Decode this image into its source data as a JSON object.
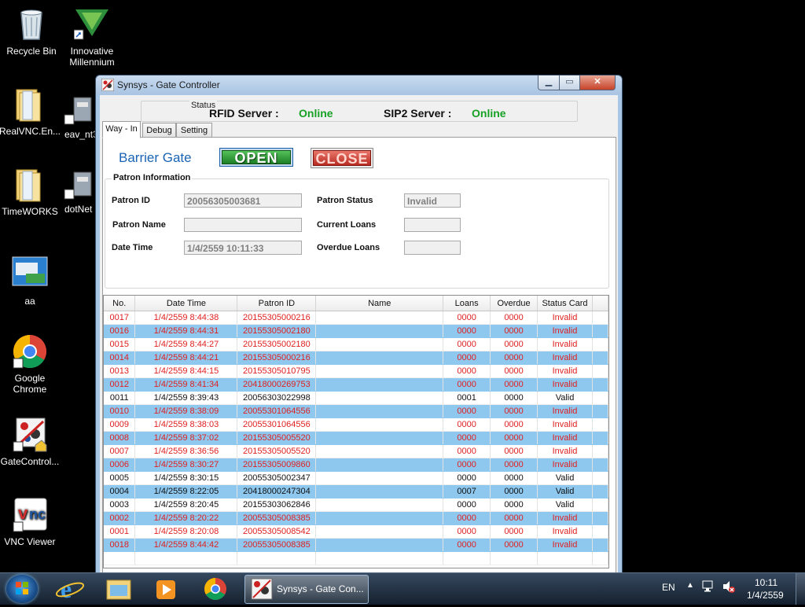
{
  "desktop": {
    "icons": [
      {
        "label": "Recycle Bin"
      },
      {
        "label": "Innovative Millennium"
      },
      {
        "label": "RealVNC.En..."
      },
      {
        "label": "eav_nt3"
      },
      {
        "label": "TimeWORKS"
      },
      {
        "label": "dotNet"
      },
      {
        "label": "aa"
      },
      {
        "label": "Google Chrome"
      },
      {
        "label": "GateControl..."
      },
      {
        "label": "VNC Viewer"
      }
    ]
  },
  "window": {
    "title": "Synsys - Gate Controller",
    "controls": {
      "minimize": "▁",
      "maximize": "▭",
      "close": "✕"
    }
  },
  "status": {
    "legend": "Status",
    "rfid_label": "RFID Server :",
    "rfid_value": "Online",
    "sip2_label": "SIP2 Server :",
    "sip2_value": "Online",
    "online_color": "#17a124"
  },
  "tabs": [
    {
      "label": "Way - In",
      "active": true
    },
    {
      "label": "Debug",
      "active": false
    },
    {
      "label": "Setting",
      "active": false
    }
  ],
  "gate": {
    "label": "Barrier Gate",
    "open_label": "OPEN",
    "close_label": "CLOSE"
  },
  "patron": {
    "legend": "Patron Information",
    "id_label": "Patron ID",
    "id_value": "20056305003681",
    "name_label": "Patron Name",
    "name_value": "",
    "datetime_label": "Date Time",
    "datetime_value": "1/4/2559 10:11:33",
    "status_label": "Patron Status",
    "status_value": "Invalid",
    "loans_label": "Current Loans",
    "loans_value": "",
    "overdue_label": "Overdue Loans",
    "overdue_value": ""
  },
  "log": {
    "columns": [
      "No.",
      "Date Time",
      "Patron ID",
      "Name",
      "Loans",
      "Overdue",
      "Status Card"
    ],
    "rows": [
      {
        "no": "0017",
        "datetime": "1/4/2559 8:44:38",
        "patron_id": "20155305000216",
        "name": "",
        "loans": "0000",
        "overdue": "0000",
        "status": "Invalid"
      },
      {
        "no": "0016",
        "datetime": "1/4/2559 8:44:31",
        "patron_id": "20155305002180",
        "name": "",
        "loans": "0000",
        "overdue": "0000",
        "status": "Invalid"
      },
      {
        "no": "0015",
        "datetime": "1/4/2559 8:44:27",
        "patron_id": "20155305002180",
        "name": "",
        "loans": "0000",
        "overdue": "0000",
        "status": "Invalid"
      },
      {
        "no": "0014",
        "datetime": "1/4/2559 8:44:21",
        "patron_id": "20155305000216",
        "name": "",
        "loans": "0000",
        "overdue": "0000",
        "status": "Invalid"
      },
      {
        "no": "0013",
        "datetime": "1/4/2559 8:44:15",
        "patron_id": "20155305010795",
        "name": "",
        "loans": "0000",
        "overdue": "0000",
        "status": "Invalid"
      },
      {
        "no": "0012",
        "datetime": "1/4/2559 8:41:34",
        "patron_id": "20418000269753",
        "name": "",
        "loans": "0000",
        "overdue": "0000",
        "status": "Invalid"
      },
      {
        "no": "0011",
        "datetime": "1/4/2559 8:39:43",
        "patron_id": "20056303022998",
        "name": "",
        "loans": "0001",
        "overdue": "0000",
        "status": "Valid"
      },
      {
        "no": "0010",
        "datetime": "1/4/2559 8:38:09",
        "patron_id": "20055301064556",
        "name": "",
        "loans": "0000",
        "overdue": "0000",
        "status": "Invalid"
      },
      {
        "no": "0009",
        "datetime": "1/4/2559 8:38:03",
        "patron_id": "20055301064556",
        "name": "",
        "loans": "0000",
        "overdue": "0000",
        "status": "Invalid"
      },
      {
        "no": "0008",
        "datetime": "1/4/2559 8:37:02",
        "patron_id": "20155305005520",
        "name": "",
        "loans": "0000",
        "overdue": "0000",
        "status": "Invalid"
      },
      {
        "no": "0007",
        "datetime": "1/4/2559 8:36:56",
        "patron_id": "20155305005520",
        "name": "",
        "loans": "0000",
        "overdue": "0000",
        "status": "Invalid"
      },
      {
        "no": "0006",
        "datetime": "1/4/2559 8:30:27",
        "patron_id": "20155305009860",
        "name": "",
        "loans": "0000",
        "overdue": "0000",
        "status": "Invalid"
      },
      {
        "no": "0005",
        "datetime": "1/4/2559 8:30:15",
        "patron_id": "20055305002347",
        "name": "",
        "loans": "0000",
        "overdue": "0000",
        "status": "Valid"
      },
      {
        "no": "0004",
        "datetime": "1/4/2559 8:22:05",
        "patron_id": "20418000247304",
        "name": "",
        "loans": "0007",
        "overdue": "0000",
        "status": "Valid"
      },
      {
        "no": "0003",
        "datetime": "1/4/2559 8:20:45",
        "patron_id": "20155303062846",
        "name": "",
        "loans": "0000",
        "overdue": "0000",
        "status": "Valid"
      },
      {
        "no": "0002",
        "datetime": "1/4/2559 8:20:22",
        "patron_id": "20055305008385",
        "name": "",
        "loans": "0000",
        "overdue": "0000",
        "status": "Invalid"
      },
      {
        "no": "0001",
        "datetime": "1/4/2559 8:20:08",
        "patron_id": "20055305008542",
        "name": "",
        "loans": "0000",
        "overdue": "0000",
        "status": "Invalid"
      },
      {
        "no": "0018",
        "datetime": "1/4/2559 8:44:42",
        "patron_id": "20055305008385",
        "name": "",
        "loans": "0000",
        "overdue": "0000",
        "status": "Invalid"
      }
    ],
    "invalid_color": "#e02020",
    "alt_row_color": "#8ec8ef"
  },
  "taskbar": {
    "active_task_label": "Synsys - Gate Con...",
    "language": "EN",
    "clock_time": "10:11",
    "clock_date": "1/4/2559"
  }
}
